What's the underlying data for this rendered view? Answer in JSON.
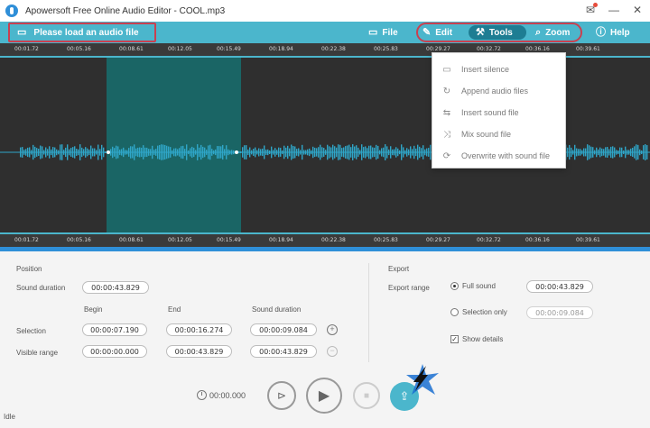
{
  "window": {
    "title": "Apowersoft Free Online Audio Editor - COOL.mp3"
  },
  "toolbar": {
    "load_label": "Please load an audio file",
    "file_label": "File",
    "edit_label": "Edit",
    "tools_label": "Tools",
    "zoom_label": "Zoom",
    "help_label": "Help"
  },
  "ruler_top": [
    "00:01.72",
    "00:05.16",
    "00:08.61",
    "00:12.05",
    "00:15.49",
    "00:18.94",
    "00:22.38",
    "00:25.83",
    "00:29.27",
    "00:32.72",
    "00:36.16",
    "00:39.61"
  ],
  "ruler_bottom": [
    "00:01.72",
    "00:05.16",
    "00:08.61",
    "00:12.05",
    "00:15.49",
    "00:18.94",
    "00:22.38",
    "00:25.83",
    "00:29.27",
    "00:32.72",
    "00:36.16",
    "00:39.61"
  ],
  "tools_menu": [
    {
      "label": "Insert silence",
      "icon": "insert-silence-icon",
      "glyph": "▭"
    },
    {
      "label": "Append audio files",
      "icon": "append-audio-icon",
      "glyph": "↻"
    },
    {
      "label": "Insert sound file",
      "icon": "insert-sound-icon",
      "glyph": "⇆"
    },
    {
      "label": "Mix sound file",
      "icon": "mix-sound-icon",
      "glyph": "⤨"
    },
    {
      "label": "Overwrite with sound file",
      "icon": "overwrite-sound-icon",
      "glyph": "⟳"
    }
  ],
  "position": {
    "heading": "Position",
    "sound_duration_label": "Sound duration",
    "sound_duration_value": "00:00:43.829",
    "col_begin": "Begin",
    "col_end": "End",
    "col_duration": "Sound duration",
    "selection_label": "Selection",
    "selection_begin": "00:00:07.190",
    "selection_end": "00:00:16.274",
    "selection_duration": "00:00:09.084",
    "visible_label": "Visible range",
    "visible_begin": "00:00:00.000",
    "visible_end": "00:00:43.829",
    "visible_duration": "00:00:43.829"
  },
  "export": {
    "heading": "Export",
    "range_label": "Export range",
    "full_sound_label": "Full sound",
    "full_sound_value": "00:00:43.829",
    "selection_only_label": "Selection only",
    "selection_only_value": "00:00:09.084",
    "show_details_label": "Show details",
    "full_sound_selected": true,
    "show_details_checked": true
  },
  "transport": {
    "time": "00:00.000"
  },
  "status": {
    "text": "Idle"
  },
  "colors": {
    "accent": "#4bb6cc",
    "highlight_border": "#c94050",
    "waveform": "#2fa6c8",
    "selection": "#147878"
  }
}
